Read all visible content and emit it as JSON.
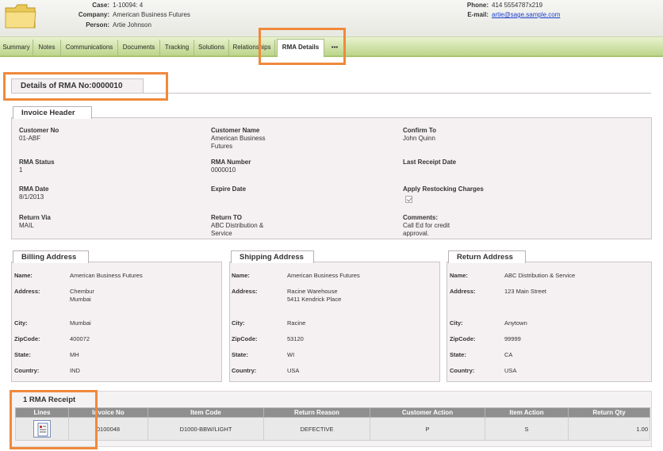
{
  "header": {
    "case_label": "Case:",
    "case_value": "1-10094: 4",
    "company_label": "Company:",
    "company_value": "American Business Futures",
    "person_label": "Person:",
    "person_value": "Artie Johnson",
    "phone_label": "Phone:",
    "phone_value": "414 5554787x219",
    "email_label": "E-mail:",
    "email_value": "artie@sage.sample.com",
    "folder_icon": "folder-icon"
  },
  "tabs": [
    {
      "label": "Summary",
      "active": false
    },
    {
      "label": "Notes",
      "active": false
    },
    {
      "label": "Communications",
      "active": false
    },
    {
      "label": "Documents",
      "active": false
    },
    {
      "label": "Tracking",
      "active": false
    },
    {
      "label": "Solutions",
      "active": false
    },
    {
      "label": "Relationships",
      "active": false
    },
    {
      "label": "RMA Details",
      "active": true
    },
    {
      "label": "•••",
      "active": false
    }
  ],
  "rma_title": "Details of RMA No:0000010",
  "invoice_header": {
    "title": "Invoice Header",
    "customer_no_label": "Customer No",
    "customer_no": "01-ABF",
    "customer_name_label": "Customer Name",
    "customer_name_line1": "American Business",
    "customer_name_line2": "Futures",
    "confirm_to_label": "Confirm To",
    "confirm_to": "John Quinn",
    "rma_status_label": "RMA Status",
    "rma_status": "1",
    "rma_number_label": "RMA Number",
    "rma_number": "0000010",
    "last_receipt_label": "Last Receipt Date",
    "last_receipt": "",
    "rma_date_label": "RMA Date",
    "rma_date": "8/1/2013",
    "expire_date_label": "Expire Date",
    "expire_date": "",
    "restocking_label": "Apply Restocking Charges",
    "restocking_checked": true,
    "return_via_label": "Return Via",
    "return_via": "MAIL",
    "return_to_label": "Return TO",
    "return_to_line1": "ABC Distribution &",
    "return_to_line2": "Service",
    "comments_label": "Comments:",
    "comments_line1": "Call Ed for credit",
    "comments_line2": "approval."
  },
  "addresses": {
    "billing": {
      "title": "Billing Address",
      "name": "American Business Futures",
      "address_line1": "Chembur",
      "address_line2": "Mumbai",
      "city": "Mumbai",
      "zip": "400072",
      "state": "MH",
      "country": "IND"
    },
    "shipping": {
      "title": "Shipping Address",
      "name": "American Business Futures",
      "address_line1": "Racine Warehouse",
      "address_line2": "5411 Kendrick Place",
      "city": "Racine",
      "zip": "53120",
      "state": "WI",
      "country": "USA"
    },
    "return": {
      "title": "Return Address",
      "name": "ABC Distribution & Service",
      "address_line1": "123 Main Street",
      "address_line2": "",
      "city": "Anytown",
      "zip": "99999",
      "state": "CA",
      "country": "USA"
    },
    "labels": {
      "name": "Name:",
      "address": "Address:",
      "city": "City:",
      "zip": "ZipCode:",
      "state": "State:",
      "country": "Country:"
    }
  },
  "receipt": {
    "title": "1 RMA Receipt",
    "columns": [
      "Lines",
      "Invoice No",
      "Item Code",
      "Return Reason",
      "Customer Action",
      "Item Action",
      "Return Qty"
    ],
    "rows": [
      {
        "invoice_no": "0100048",
        "item_code": "D1000-BBW/LIGHT",
        "return_reason": "DEFECTIVE",
        "customer_action": "P",
        "item_action": "S",
        "return_qty": "1.00"
      }
    ]
  },
  "colors": {
    "accent_callout": "#f0893b",
    "tab_bar_green": "#bcd58a",
    "table_header_gray": "#8f8f8f",
    "link_blue": "#1a3ecc"
  }
}
